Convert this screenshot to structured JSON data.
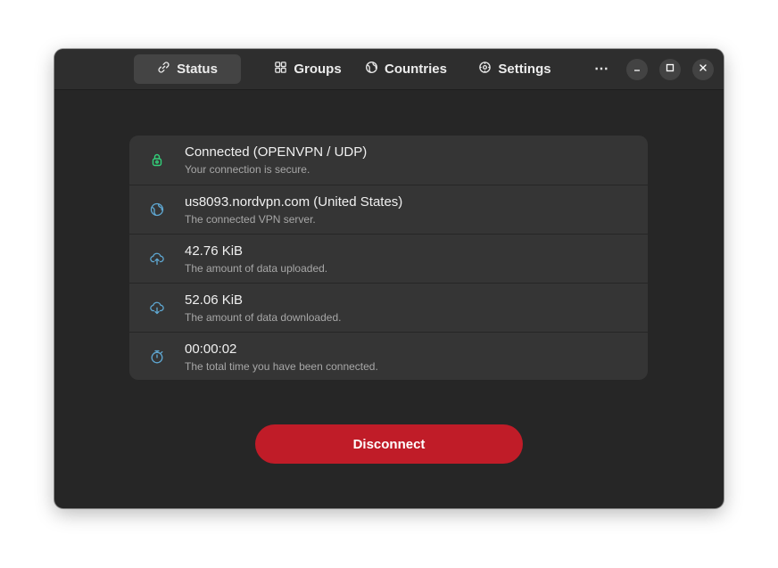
{
  "tabs": [
    {
      "label": "Status",
      "icon": "link-icon",
      "active": true
    },
    {
      "label": "Groups",
      "icon": "grid-icon",
      "active": false
    },
    {
      "label": "Countries",
      "icon": "globe-icon",
      "active": false
    },
    {
      "label": "Settings",
      "icon": "gear-icon",
      "active": false
    }
  ],
  "menu_label": "⋯",
  "status": {
    "rows": [
      {
        "title": "Connected (OPENVPN / UDP)",
        "subtitle": "Your connection is secure.",
        "icon": "lock-icon",
        "icon_color": "#33d17a"
      },
      {
        "title": "us8093.nordvpn.com (United States)",
        "subtitle": "The connected VPN server.",
        "icon": "globe-icon",
        "icon_color": "#5fa8d3"
      },
      {
        "title": "42.76 KiB",
        "subtitle": "The amount of data uploaded.",
        "icon": "cloud-upload-icon",
        "icon_color": "#5fa8d3"
      },
      {
        "title": "52.06 KiB",
        "subtitle": "The amount of data downloaded.",
        "icon": "cloud-download-icon",
        "icon_color": "#5fa8d3"
      },
      {
        "title": "00:00:02",
        "subtitle": "The total time you have been connected.",
        "icon": "stopwatch-icon",
        "icon_color": "#5fa8d3"
      }
    ]
  },
  "disconnect_label": "Disconnect",
  "colors": {
    "window_bg": "#262626",
    "headerbar_bg": "#2e2e2e",
    "card_bg": "#353535",
    "accent_red": "#c01c28",
    "secure_green": "#33d17a",
    "icon_blue": "#5fa8d3"
  }
}
